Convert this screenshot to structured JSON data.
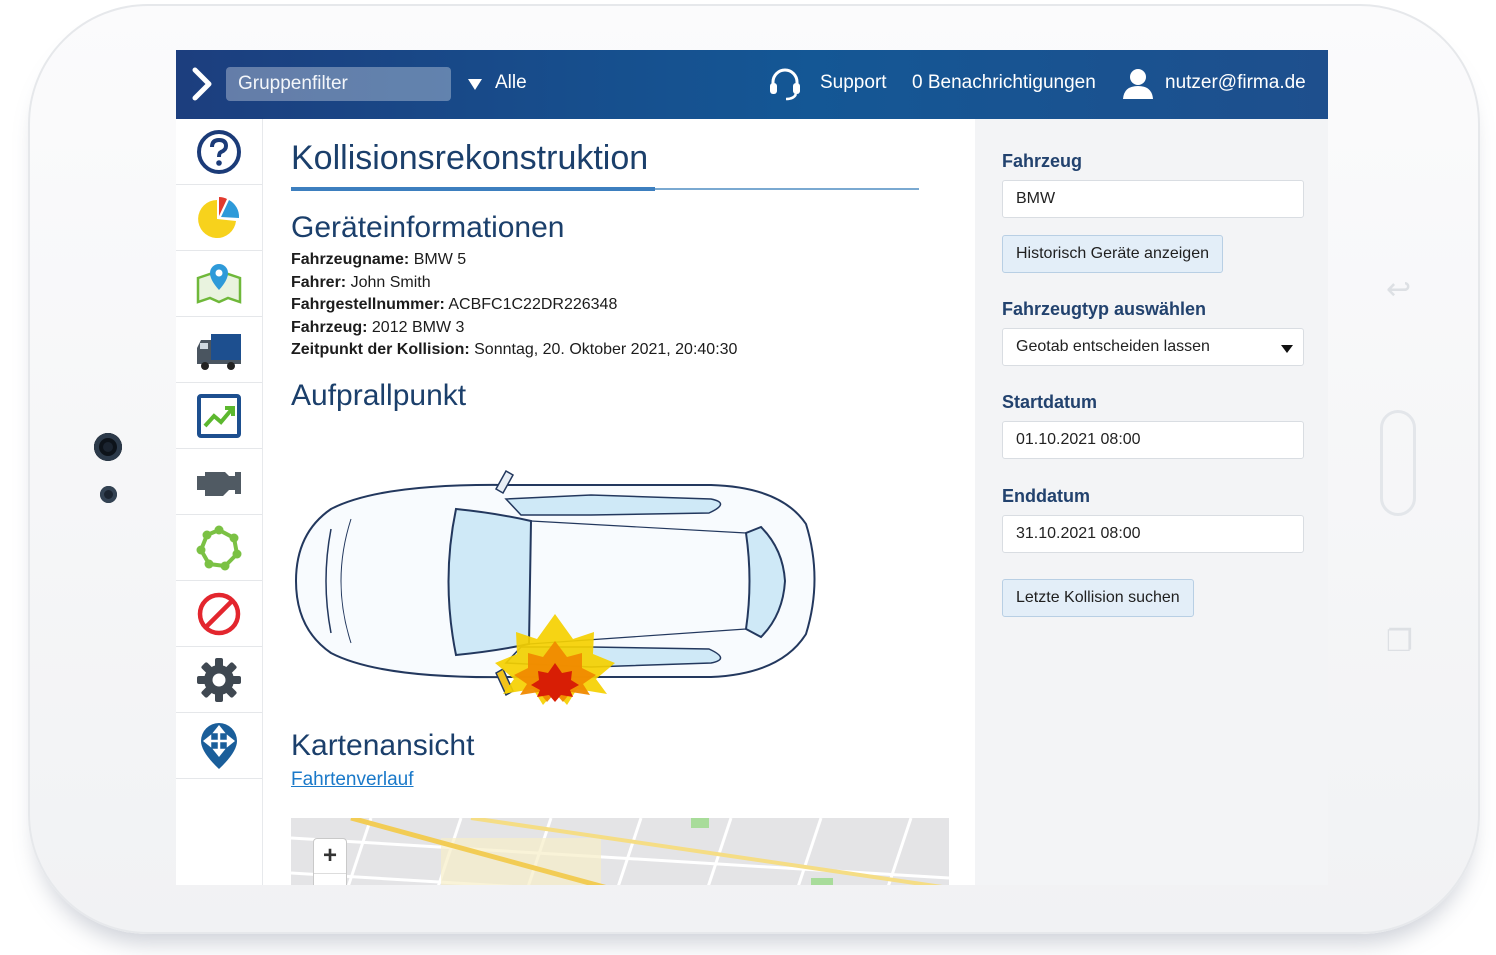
{
  "topbar": {
    "group_filter_label": "Gruppenfilter",
    "group_value": "Alle",
    "support_label": "Support",
    "notifications_label": "0 Benachrichtigungen",
    "user_email": "nutzer@firma.de"
  },
  "sidebar": {
    "items": [
      {
        "icon": "help-icon"
      },
      {
        "icon": "pie-chart-icon"
      },
      {
        "icon": "map-pin-icon"
      },
      {
        "icon": "truck-icon"
      },
      {
        "icon": "trend-chart-icon"
      },
      {
        "icon": "engine-icon"
      },
      {
        "icon": "zone-icon"
      },
      {
        "icon": "prohibited-icon"
      },
      {
        "icon": "gear-icon"
      },
      {
        "icon": "move-pin-icon"
      }
    ]
  },
  "main": {
    "title": "Kollisionsrekonstruktion",
    "device_section_title": "Geräteinformationen",
    "device_info": [
      {
        "label": "Fahrzeugname:",
        "value": "BMW 5"
      },
      {
        "label": "Fahrer:",
        "value": "John Smith"
      },
      {
        "label": "Fahrgestellnummer:",
        "value": "ACBFC1C22DR226348"
      },
      {
        "label": "Fahrzeug:",
        "value": "2012 BMW 3"
      },
      {
        "label": "Zeitpunkt der Kollision:",
        "value": "Sonntag, 20. Oktober 2021, 20:40:30"
      }
    ],
    "impact_section_title": "Aufprallpunkt",
    "map_section_title": "Kartenansicht",
    "trip_link": "Fahrtenverlauf",
    "zoom_in": "+",
    "zoom_out": "−"
  },
  "panel": {
    "vehicle_label": "Fahrzeug",
    "vehicle_value": "BMW",
    "history_button": "Historisch Geräte anzeigen",
    "vehicle_type_label": "Fahrzeugtyp auswählen",
    "vehicle_type_value": "Geotab entscheiden lassen",
    "start_label": "Startdatum",
    "start_value": "01.10.2021 08:00",
    "end_label": "Enddatum",
    "end_value": "31.10.2021 08:00",
    "search_button": "Letzte Kollision suchen"
  },
  "colors": {
    "topbar_start": "#1c3e7e",
    "topbar_end": "#145795",
    "heading": "#1b3f6b",
    "link": "#1a79c9",
    "impact_outer": "#f5d000",
    "impact_mid": "#f08a00",
    "impact_inner": "#d81e05"
  }
}
